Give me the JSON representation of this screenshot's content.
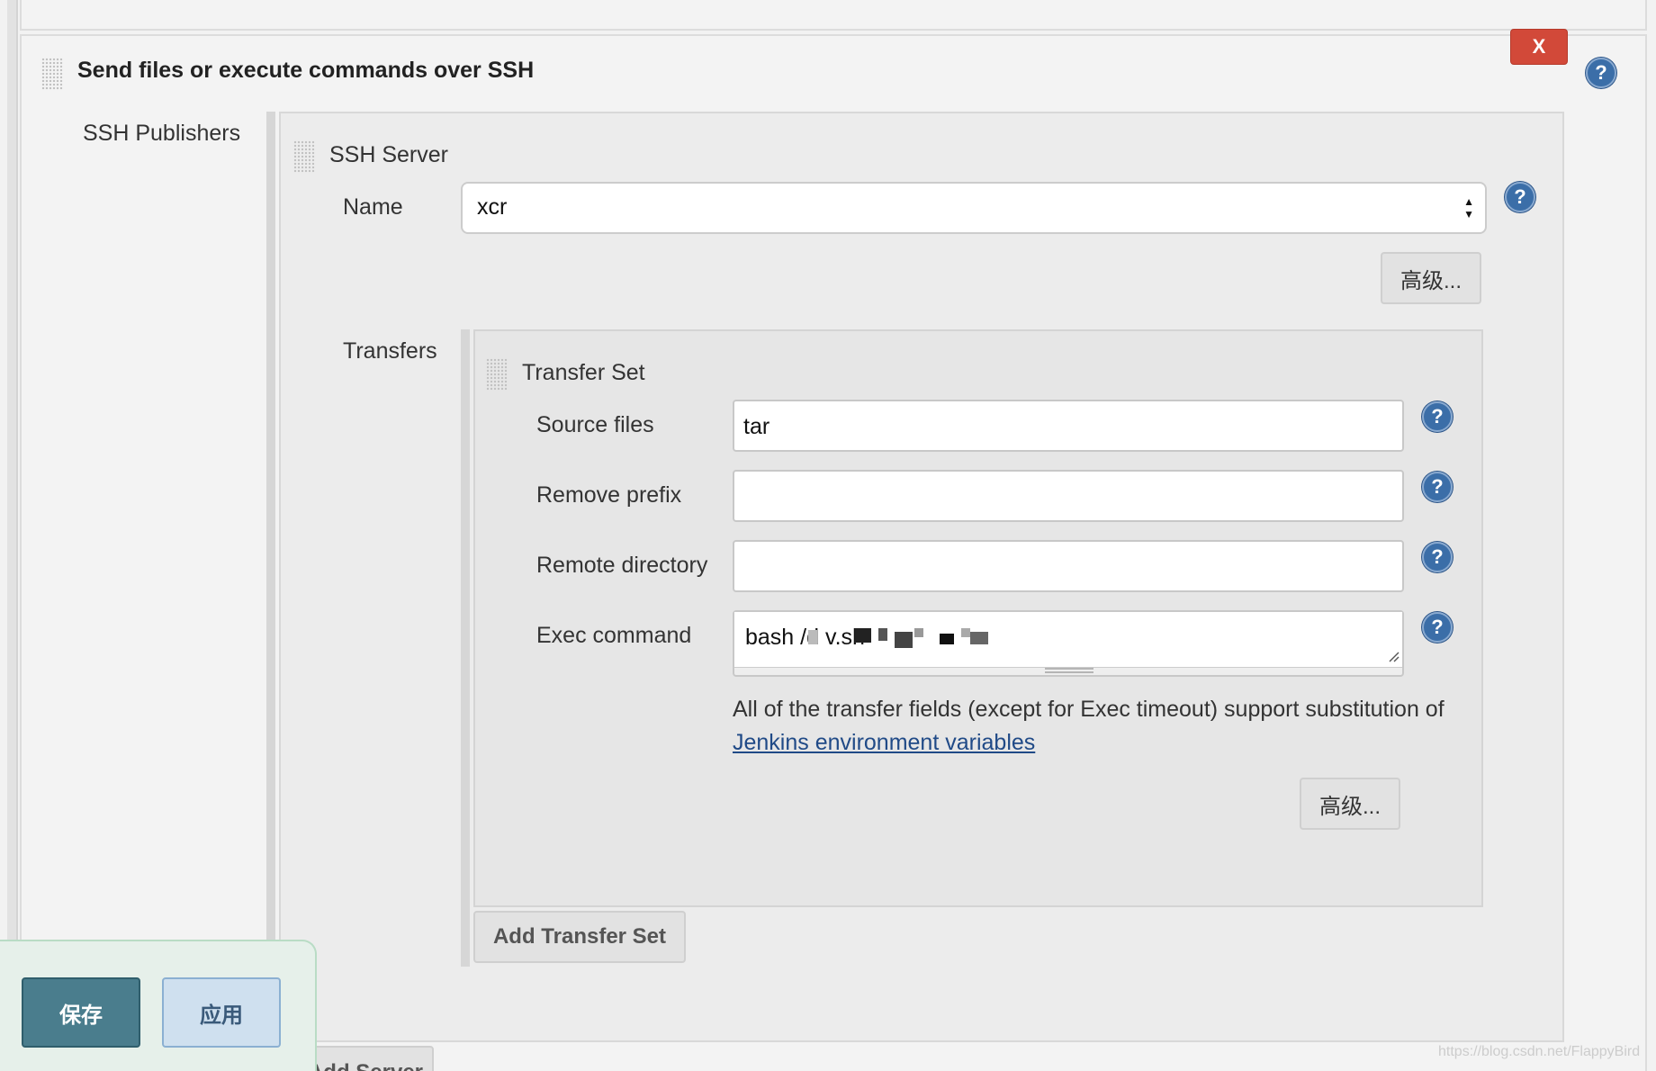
{
  "section": {
    "title": "Send files or execute commands over SSH",
    "delete_label": "X"
  },
  "help_icon_glyph": "?",
  "ssh_publishers": {
    "label": "SSH Publishers",
    "server": {
      "title": "SSH Server",
      "name_label": "Name",
      "name_value": "xcr",
      "advanced_label": "高级..."
    },
    "transfers_label": "Transfers",
    "transfer_set": {
      "title": "Transfer Set",
      "source_files_label": "Source files",
      "source_files_value": "tar",
      "remove_prefix_label": "Remove prefix",
      "remove_prefix_value": "",
      "remote_directory_label": "Remote directory",
      "remote_directory_value": "",
      "exec_command_label": "Exec command",
      "exec_command_value": "bash /d                       v.sh",
      "note_text": "All of the transfer fields (except for Exec timeout) support substitution of ",
      "note_link": "Jenkins environment variables",
      "advanced_label": "高级..."
    },
    "add_transfer_set_label": "Add Transfer Set",
    "add_server_label": "Add Server"
  },
  "bottom_bar": {
    "save_label": "保存",
    "apply_label": "应用"
  },
  "watermark": "https://blog.csdn.net/FlappyBird"
}
